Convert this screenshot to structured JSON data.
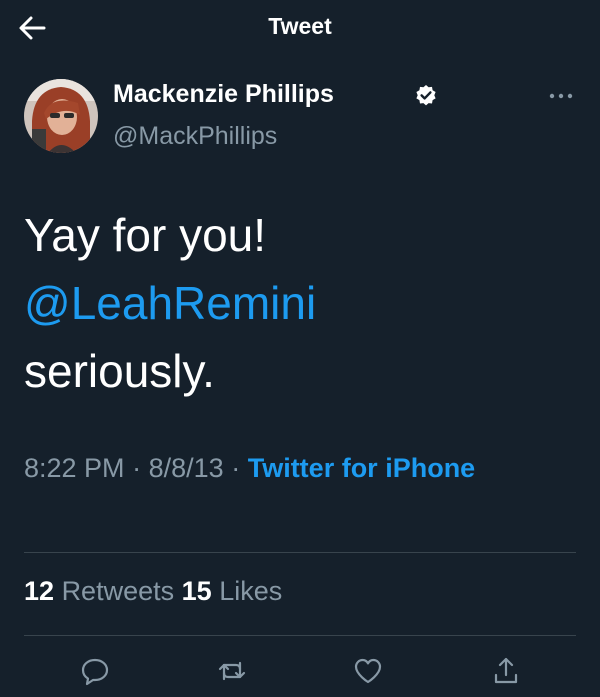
{
  "header": {
    "title": "Tweet"
  },
  "author": {
    "display_name": "Mackenzie Phillips",
    "handle": "@MackPhillips",
    "verified": true
  },
  "tweet": {
    "text_before": "Yay for you!",
    "mention": "@LeahRemini",
    "text_after": "seriously."
  },
  "meta": {
    "time": "8:22 PM",
    "date": "8/8/13",
    "separator": "·",
    "source": "Twitter for iPhone"
  },
  "stats": {
    "retweets_count": "12",
    "retweets_label": "Retweets",
    "likes_count": "15",
    "likes_label": "Likes"
  },
  "icons": {
    "back": "back-arrow-icon",
    "verified": "verified-badge-icon",
    "more": "more-icon",
    "reply": "reply-icon",
    "retweet": "retweet-icon",
    "like": "like-icon",
    "share": "share-icon"
  },
  "colors": {
    "background": "#15202b",
    "accent": "#1d9bf0",
    "secondary_text": "#8899a6",
    "divider": "#38444d"
  }
}
